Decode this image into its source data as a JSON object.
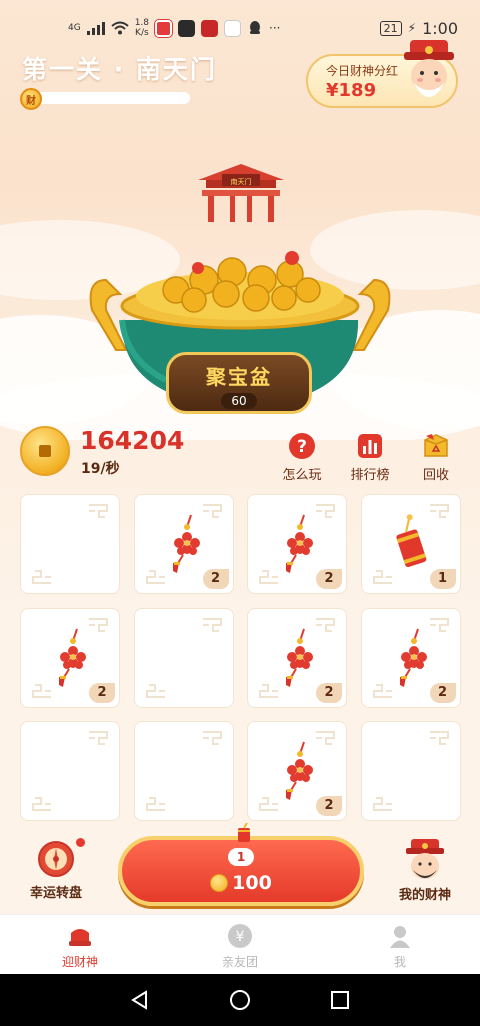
{
  "status_bar": {
    "network": "4G",
    "speed": "1.8",
    "speed_unit": "K/s",
    "battery": "21",
    "time": "1:00",
    "more": "···"
  },
  "header": {
    "level_title": "第一关 · 南天门",
    "progress_badge": "财",
    "progress_fraction": 0.04,
    "dividend_label": "今日财神分红",
    "dividend_value": "¥189"
  },
  "gate_sign": "南天门",
  "pot": {
    "label": "聚宝盆",
    "count": "60"
  },
  "stats": {
    "total_coins": "164204",
    "rate": "19/秒"
  },
  "actions": [
    {
      "label": "怎么玩",
      "icon": "question-icon"
    },
    {
      "label": "排行榜",
      "icon": "leaderboard-icon"
    },
    {
      "label": "回收",
      "icon": "recycle-box-icon"
    }
  ],
  "grid": {
    "cells": [
      {
        "item": "",
        "level": ""
      },
      {
        "item": "chinese-knot",
        "level": "2"
      },
      {
        "item": "chinese-knot",
        "level": "2"
      },
      {
        "item": "firecracker",
        "level": "1"
      },
      {
        "item": "chinese-knot",
        "level": "2"
      },
      {
        "item": "",
        "level": ""
      },
      {
        "item": "chinese-knot",
        "level": "2"
      },
      {
        "item": "chinese-knot",
        "level": "2"
      },
      {
        "item": "",
        "level": ""
      },
      {
        "item": "",
        "level": ""
      },
      {
        "item": "chinese-knot",
        "level": "2"
      },
      {
        "item": "",
        "level": ""
      }
    ]
  },
  "bottom": {
    "lucky_wheel_label": "幸运转盘",
    "buy_level": "1",
    "buy_cost": "100",
    "my_god_label": "我的财神"
  },
  "tabs": [
    {
      "label": "迎财神",
      "icon": "god-hat-icon",
      "active": true
    },
    {
      "label": "亲友团",
      "icon": "yuan-coin-icon",
      "active": false
    },
    {
      "label": "我",
      "icon": "person-icon",
      "active": false
    }
  ],
  "colors": {
    "accent_red": "#e0392b",
    "gold": "#f2b021",
    "brown_text": "#5a2a12"
  }
}
